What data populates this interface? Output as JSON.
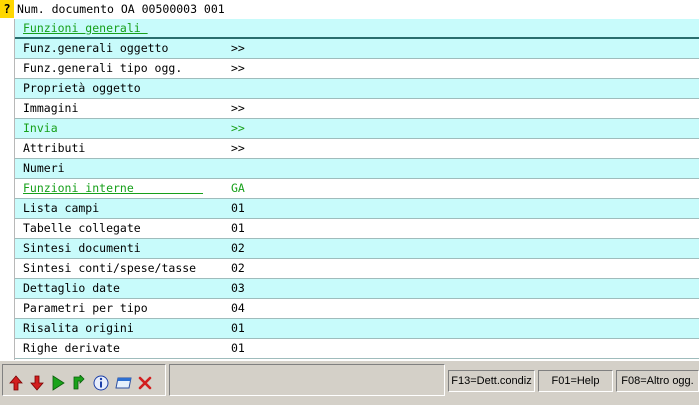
{
  "title": "Num. documento OA 00500003 001",
  "help_mark": "?",
  "rows": [
    {
      "label": "Funzioni generali ",
      "value": "",
      "style": "green-header"
    },
    {
      "label": "Funz.generali oggetto",
      "value": ">>"
    },
    {
      "label": "Funz.generali tipo ogg.",
      "value": ">>"
    },
    {
      "label": "Proprietà oggetto",
      "value": ""
    },
    {
      "label": "Immagini",
      "value": ">>"
    },
    {
      "label": "Invia",
      "value": ">>",
      "style": "green"
    },
    {
      "label": "Attributi",
      "value": ">>"
    },
    {
      "label": "Numeri",
      "value": ""
    },
    {
      "label": "Funzioni interne          ",
      "value": "GA",
      "style": "green-header"
    },
    {
      "label": "Lista campi",
      "value": "01"
    },
    {
      "label": "Tabelle collegate",
      "value": "01"
    },
    {
      "label": "Sintesi documenti",
      "value": "02"
    },
    {
      "label": "Sintesi conti/spese/tasse",
      "value": "02"
    },
    {
      "label": "Dettaglio date",
      "value": "03"
    },
    {
      "label": "Parametri per tipo",
      "value": "04"
    },
    {
      "label": "Risalita origini",
      "value": "01"
    },
    {
      "label": "Righe derivate",
      "value": "01"
    }
  ],
  "toolbar": {
    "icons": [
      "arrow-up-icon",
      "arrow-down-icon",
      "play-icon",
      "refresh-icon",
      "info-icon",
      "window-icon",
      "close-icon"
    ]
  },
  "function_keys": [
    {
      "label": "F13=Dett.condiz"
    },
    {
      "label": "F01=Help"
    },
    {
      "label": "F08=Altro ogg."
    }
  ],
  "colors": {
    "row_cyan": "#c8fbfb",
    "green_text": "#17a01a",
    "statusbar": "#d4d0c8",
    "help_mark_bg": "#ffd700"
  }
}
